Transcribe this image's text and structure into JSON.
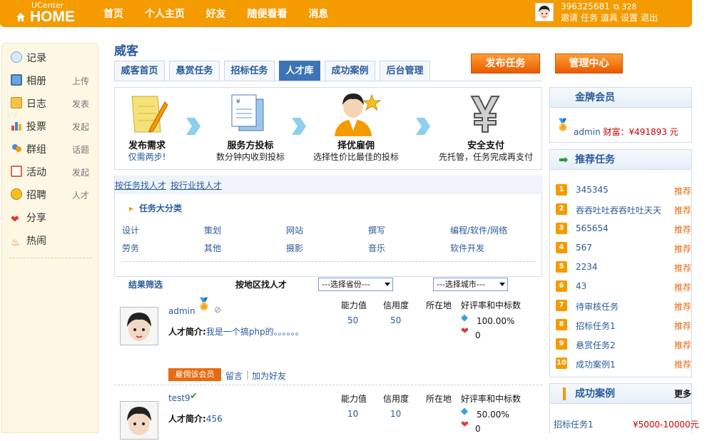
{
  "topbar": {
    "logo_small": "UCenter",
    "logo_big": "HOME",
    "nav": [
      "首页",
      "个人主页",
      "好友",
      "随便看看",
      "消息"
    ],
    "user_id": "396325681",
    "credit": "328",
    "user_links": [
      "邀请",
      "任务",
      "道具",
      "设置",
      "退出"
    ]
  },
  "sidebar": {
    "items": [
      {
        "label": "记录",
        "sub": "",
        "icon": "speech-bubble-icon"
      },
      {
        "label": "相册",
        "sub": "上传",
        "icon": "photo-icon"
      },
      {
        "label": "日志",
        "sub": "发表",
        "icon": "notebook-icon"
      },
      {
        "label": "投票",
        "sub": "发起",
        "icon": "bar-chart-icon"
      },
      {
        "label": "群组",
        "sub": "话题",
        "icon": "group-icon"
      },
      {
        "label": "活动",
        "sub": "发起",
        "icon": "calendar-icon"
      },
      {
        "label": "招聘",
        "sub": "人才",
        "icon": "coins-icon"
      },
      {
        "label": "分享",
        "sub": "",
        "icon": "hearts-icon"
      },
      {
        "label": "热闹",
        "sub": "",
        "icon": "flame-icon"
      }
    ]
  },
  "page": {
    "title": "威客",
    "tabs": [
      "威客首页",
      "悬赏任务",
      "招标任务",
      "人才库",
      "成功案例",
      "后台管理"
    ],
    "active_tab": "人才库",
    "publish_button": "发布任务",
    "manage_button": "管理中心"
  },
  "steps": [
    {
      "title": "发布需求",
      "desc": "仅需两步!"
    },
    {
      "title": "服务方投标",
      "desc": "数分钟内收到投标"
    },
    {
      "title": "择优雇佣",
      "desc": "选择性价比最佳的投标"
    },
    {
      "title": "安全支付",
      "desc": "先托管，任务完成再支付"
    }
  ],
  "category": {
    "tabs": [
      "按任务找人才",
      "按行业找人才"
    ],
    "heading": "任务大分类",
    "items": [
      "设计",
      "策划",
      "网站",
      "撰写",
      "编程/软件/网络",
      "劳务",
      "其他",
      "摄影",
      "音乐",
      "软件开发"
    ]
  },
  "filter": {
    "label": "结果筛选",
    "area_label": "按地区找人才",
    "province": "---选择省份---",
    "city": "---选择城市---"
  },
  "columns": {
    "ability": "能力值",
    "credit": "信用度",
    "location": "所在地",
    "rate": "好评率和中标数"
  },
  "people": [
    {
      "name": "admin",
      "intro_label": "人才简介:",
      "intro": "我是一个搞php的。。。。。。",
      "ability": "50",
      "credit": "50",
      "rate": "100.00%",
      "wins": "0",
      "hire": "雇佣该会员",
      "message": "留言",
      "add_friend": "加为好友"
    },
    {
      "name": "test9",
      "intro_label": "人才简介:",
      "intro": "456",
      "ability": "10",
      "credit": "10",
      "rate": "50.00%",
      "wins": "0"
    }
  ],
  "gold_member": {
    "title": "金牌会员",
    "name": "admin",
    "wealth_label": "财富：",
    "wealth": "¥491893 元"
  },
  "recommended": {
    "title": "推荐任务",
    "tag": "推荐",
    "items": [
      "345345",
      "吞吞吐吐吞吞吐吐天天",
      "565654",
      "567",
      "2234",
      "43",
      "待审核任务",
      "招标任务1",
      "悬赏任务2",
      "成功案例1"
    ]
  },
  "cases": {
    "title": "成功案例",
    "more": "更多",
    "items": [
      {
        "name": "招标任务1",
        "price": "¥5000-10000元"
      }
    ]
  },
  "colors": {
    "accent": "#f49b00",
    "link": "#2a5a9a",
    "tab_active": "#3c74b6",
    "button": "#e85a00"
  }
}
